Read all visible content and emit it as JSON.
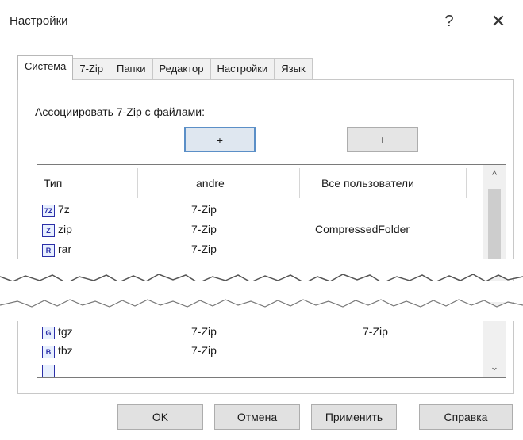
{
  "window": {
    "title": "Настройки",
    "help_glyph": "?",
    "close_glyph": "✕"
  },
  "tabs": [
    {
      "label": "Система",
      "active": true
    },
    {
      "label": "7-Zip",
      "active": false
    },
    {
      "label": "Папки",
      "active": false
    },
    {
      "label": "Редактор",
      "active": false
    },
    {
      "label": "Настройки",
      "active": false
    },
    {
      "label": "Язык",
      "active": false
    }
  ],
  "system": {
    "assoc_label": "Ассоциировать 7-Zip с файлами:",
    "plus_user": "+",
    "plus_all": "+"
  },
  "list": {
    "columns": [
      "Тип",
      "andre",
      "Все пользователи"
    ],
    "rows_top": [
      {
        "icon": "7Z",
        "ext": "7z",
        "user": "7-Zip",
        "all": ""
      },
      {
        "icon": "Z",
        "ext": "zip",
        "user": "7-Zip",
        "all": "CompressedFolder"
      },
      {
        "icon": "R",
        "ext": "rar",
        "user": "7-Zip",
        "all": ""
      }
    ],
    "rows_bottom": [
      {
        "icon": "G",
        "ext": "tgz",
        "user": "7-Zip",
        "all": "7-Zip"
      },
      {
        "icon": "B",
        "ext": "tbz",
        "user": "7-Zip",
        "all": ""
      }
    ],
    "scroll_up": "^",
    "scroll_down": "⌄"
  },
  "footer": {
    "ok": "OK",
    "cancel": "Отмена",
    "apply": "Применить",
    "help": "Справка"
  },
  "colors": {
    "focus_border": "#5b8fc7",
    "icon_blue": "#2b2fa8"
  }
}
